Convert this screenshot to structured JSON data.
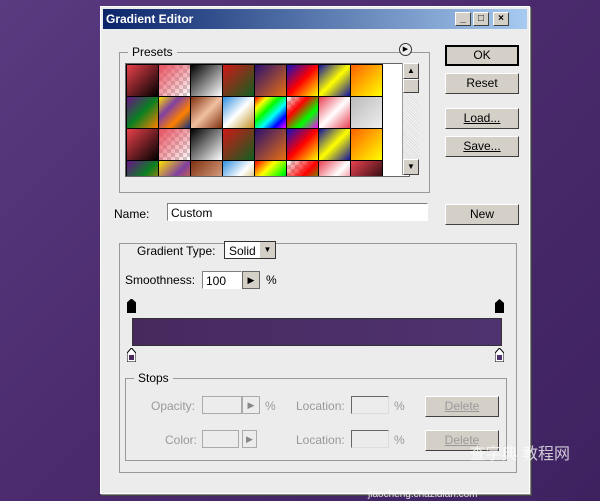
{
  "window": {
    "title": "Gradient Editor",
    "min": "_",
    "max": "□",
    "close": "×"
  },
  "presets": {
    "label": "Presets",
    "menu_icon": "play-circle-icon",
    "swatches": [
      [
        "#e8404a",
        "#000"
      ],
      [
        "#e85060",
        "transparent"
      ],
      [
        "#000",
        "#fff"
      ],
      [
        "#d01818",
        "#106020"
      ],
      [
        "#2a1070",
        "#e87010"
      ],
      [
        "#1010c0",
        "#ff0000",
        "#ffff00"
      ],
      [
        "#1010a0",
        "#ffff00",
        "#1010a0"
      ],
      [
        "#ff6000",
        "#ffff00"
      ],
      [
        "#6a1088",
        "#0a8020",
        "#ff8000"
      ],
      [
        "#ffe000",
        "#8040a0",
        "#ff8000",
        "#103080"
      ],
      [
        "#803010",
        "#f0c0a0",
        "#803010"
      ],
      [
        "#3090e0",
        "#fff",
        "#c09020"
      ],
      [
        "#ff0000",
        "#ffff00",
        "#00ff00",
        "#00ffff",
        "#0000ff",
        "#ff00ff"
      ],
      [
        "transparent",
        "#ff0000",
        "#00ff00",
        "#ff00ff"
      ],
      [
        "#e84050",
        "#fff",
        "#e84050"
      ],
      [
        "#bbb",
        "#eee"
      ],
      [
        "#e8404a",
        "#000"
      ],
      [
        "#e85060",
        "transparent"
      ],
      [
        "#000",
        "#fff"
      ],
      [
        "#d01818",
        "#106020"
      ],
      [
        "#2a1070",
        "#e87010"
      ],
      [
        "#1010c0",
        "#ff0000",
        "#ffff00"
      ],
      [
        "#1010a0",
        "#ffff00",
        "#1010a0"
      ],
      [
        "#ff6000",
        "#ffff00"
      ],
      [
        "#6a1088",
        "#0a8020",
        "#ff8000"
      ],
      [
        "#ffe000",
        "#8040a0",
        "#ff8000"
      ],
      [
        "#803010",
        "#f0c0a0"
      ],
      [
        "#3090e0",
        "#fff",
        "#c09020"
      ],
      [
        "#ff0000",
        "#ffff00",
        "#00ff00",
        "#0000ff"
      ],
      [
        "transparent",
        "#ff0000",
        "#00ff00"
      ],
      [
        "#e84050",
        "#fff",
        "#e84050"
      ],
      [
        "#e84050",
        "#000"
      ]
    ]
  },
  "buttons": {
    "ok": "OK",
    "reset": "Reset",
    "load": "Load...",
    "save": "Save...",
    "new": "New"
  },
  "name": {
    "label": "Name:",
    "value": "Custom"
  },
  "gradient": {
    "type_label": "Gradient Type:",
    "type_value": "Solid",
    "smoothness_label": "Smoothness:",
    "smoothness_value": "100",
    "percent": "%",
    "start_color": "#48295e",
    "end_color": "#4f3370"
  },
  "stops": {
    "label": "Stops",
    "opacity_label": "Opacity:",
    "color_label": "Color:",
    "location_label": "Location:",
    "percent": "%",
    "delete": "Delete"
  },
  "watermark": {
    "line1": "查字典 教程网",
    "line2": "jiaocheng.chazidian.com"
  }
}
